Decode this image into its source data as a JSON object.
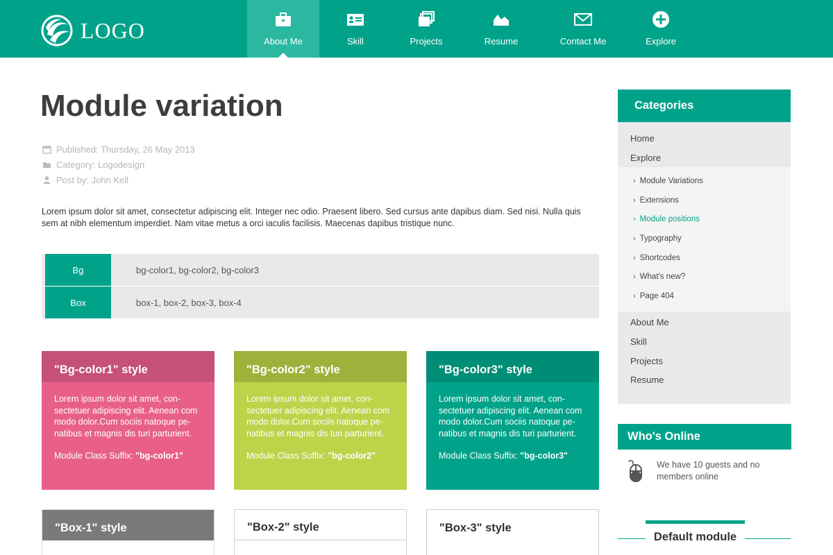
{
  "brand": {
    "logo_text": "LOGO"
  },
  "nav": [
    {
      "label": "About Me",
      "icon": "briefcase-icon",
      "active": true
    },
    {
      "label": "Skill",
      "icon": "id-card-icon",
      "active": false
    },
    {
      "label": "Projects",
      "icon": "stacked-windows-icon",
      "active": false
    },
    {
      "label": "Resume",
      "icon": "area-chart-icon",
      "active": false
    },
    {
      "label": "Contact Me",
      "icon": "envelope-icon",
      "active": false
    },
    {
      "label": "Explore",
      "icon": "plus-circle-icon",
      "active": false
    }
  ],
  "article": {
    "title": "Module variation",
    "published": "Published: Thursday, 26 May 2013",
    "category": "Category: Logodesign",
    "author": "Post by: John Kell",
    "intro": "Lorem ipsum dolor sit amet, consectetur adipiscing elit. Integer nec odio. Praesent libero. Sed cursus ante dapibus diam. Sed nisi. Nulla quis sem at nibh elementum imperdiet. Nam vitae metus a orci iaculis facilisis. Maecenas dapibus tristique nunc."
  },
  "info_table": [
    {
      "key": "Bg",
      "value": "bg-color1, bg-color2, bg-color3"
    },
    {
      "key": "Box",
      "value": "box-1, box-2, box-3, box-4"
    }
  ],
  "modules": [
    {
      "title": "\"Bg-color1\" style",
      "body": "Lorem ipsum dolor sit amet, con-sectetuer adipiscing elit. Aenean com modo dolor.Cum sociis natoque pe-natibus et magnis dis turi parturient.",
      "suffix_label": "Module Class Suffix: ",
      "suffix_value": "\"bg-color1\""
    },
    {
      "title": "\"Bg-color2\" style",
      "body": "Lorem ipsum dolor sit amet, con-sectetuer adipiscing elit. Aenean com modo dolor.Cum sociis natoque pe-natibus et magnis dis turi parturient.",
      "suffix_label": "Module Class Suffix: ",
      "suffix_value": "\"bg-color2\""
    },
    {
      "title": "\"Bg-color3\" style",
      "body": "Lorem ipsum dolor sit amet, con-sectetuer adipiscing elit. Aenean com modo dolor.Cum sociis natoque pe-natibus et magnis dis turi parturient.",
      "suffix_label": "Module Class Suffix: ",
      "suffix_value": "\"bg-color3\""
    }
  ],
  "boxes": [
    {
      "title": "\"Box-1\" style"
    },
    {
      "title": "\"Box-2\" style"
    },
    {
      "title": "\"Box-3\" style"
    }
  ],
  "sidebar": {
    "categories_title": "Categories",
    "top_items": [
      "Home",
      "Explore"
    ],
    "sub_items": [
      {
        "label": "Module Variations",
        "selected": false
      },
      {
        "label": "Extensions",
        "selected": false
      },
      {
        "label": "Module positions",
        "selected": true
      },
      {
        "label": "Typography",
        "selected": false
      },
      {
        "label": "Shortcodes",
        "selected": false
      },
      {
        "label": "What's new?",
        "selected": false
      },
      {
        "label": "Page 404",
        "selected": false
      }
    ],
    "bottom_items": [
      "About Me",
      "Skill",
      "Projects",
      "Resume"
    ],
    "online_title": "Who's Online",
    "online_text": "We have 10 guests and no members online",
    "default_module_title": "Default module"
  },
  "colors": {
    "accent": "#00a38a",
    "bg_color1": "#e8608a",
    "bg_color2": "#bcd44a",
    "bg_color3": "#00a38a"
  }
}
